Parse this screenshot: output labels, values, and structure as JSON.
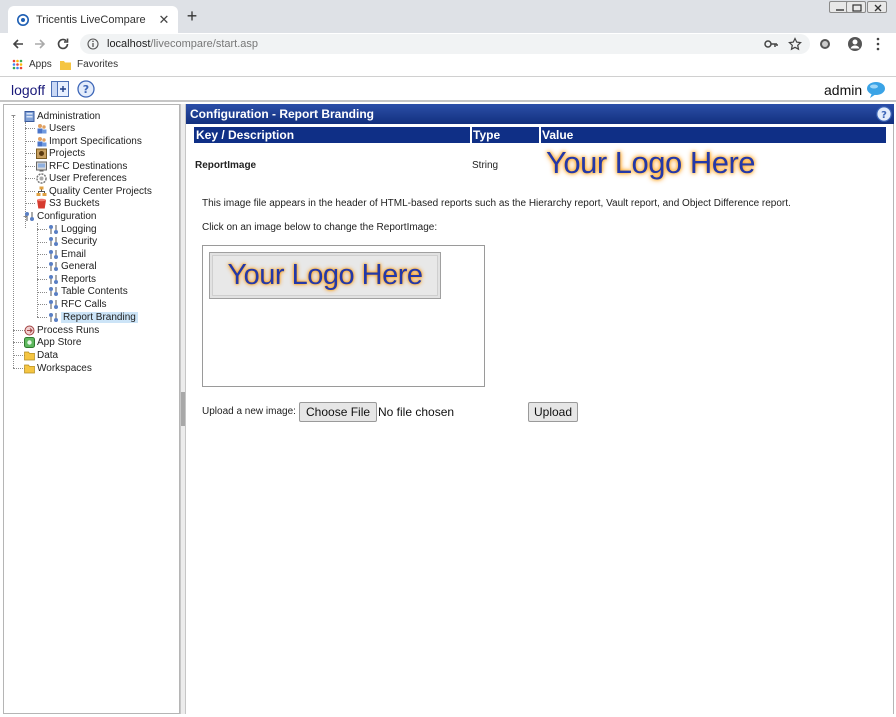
{
  "browser": {
    "tab_title": "Tricentis LiveCompare",
    "url_host": "localhost",
    "url_path": "/livecompare/start.asp",
    "bookmarks": {
      "apps": "Apps",
      "favorites": "Favorites"
    }
  },
  "header": {
    "logoff": "logoff",
    "user": "admin"
  },
  "tree": {
    "administration": "Administration",
    "users": "Users",
    "import_specifications": "Import Specifications",
    "projects": "Projects",
    "rfc_destinations": "RFC Destinations",
    "user_preferences": "User Preferences",
    "quality_center_projects": "Quality Center Projects",
    "s3_buckets": "S3 Buckets",
    "configuration": "Configuration",
    "logging": "Logging",
    "security": "Security",
    "email": "Email",
    "general": "General",
    "reports": "Reports",
    "table_contents": "Table Contents",
    "rfc_calls": "RFC Calls",
    "report_branding": "Report Branding",
    "process_runs": "Process Runs",
    "app_store": "App Store",
    "data": "Data",
    "workspaces": "Workspaces"
  },
  "main": {
    "title": "Configuration - Report Branding",
    "columns": {
      "key": "Key / Description",
      "type": "Type",
      "value": "Value"
    },
    "row": {
      "key": "ReportImage",
      "type": "String",
      "logo_text": "Your Logo Here"
    },
    "description": "This image file appears in the header of HTML-based reports such as the Hierarchy report, Vault report, and Object Difference report.",
    "click_hint": "Click on an image below to change the ReportImage:",
    "thumbnail_text": "Your Logo Here",
    "upload_label": "Upload a new image:",
    "choose_file": "Choose File",
    "no_file": "No file chosen",
    "upload_button": "Upload"
  },
  "colors": {
    "title_bar": "#1b3a8c",
    "grid_header": "#0f2f86",
    "logo_text": "#2438a8",
    "logo_glow": "#ff8a00",
    "selected_node": "#cce4f7"
  },
  "icons": {
    "tab": "livecompare-favicon",
    "admin": "server-icon",
    "users": "users-icon",
    "projects": "projects-icon",
    "config": "config-icon",
    "s3": "bucket-icon",
    "folder": "folder-icon"
  }
}
